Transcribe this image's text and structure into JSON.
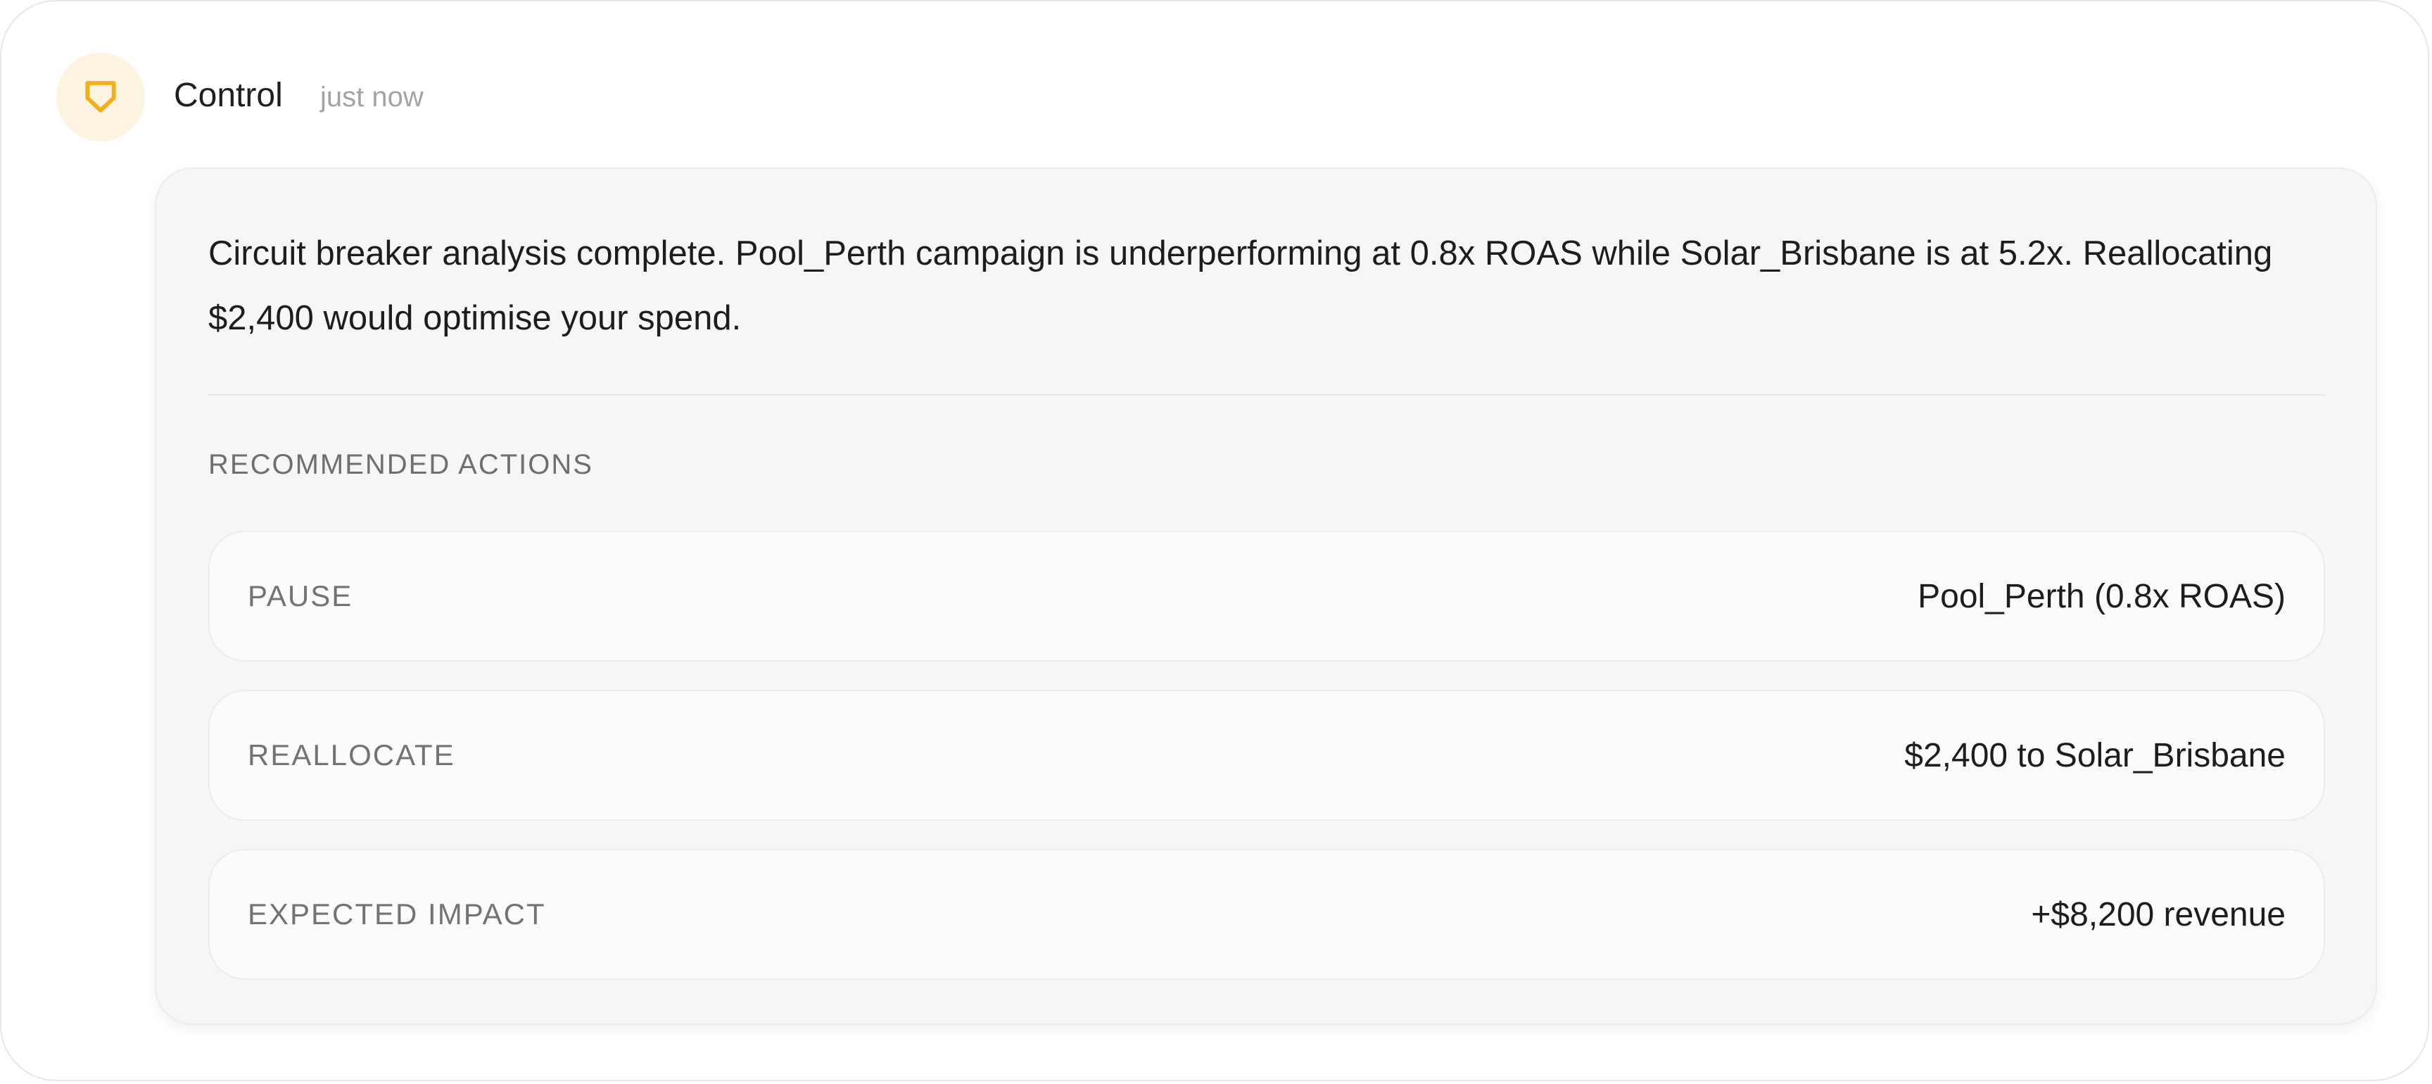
{
  "header": {
    "sender": "Control",
    "timestamp": "just now",
    "avatar_icon": "shield-icon",
    "avatar_color": "#f2b01e"
  },
  "message": {
    "text": "Circuit breaker analysis complete. Pool_Perth campaign is underperforming at 0.8x ROAS while Solar_Brisbane is at 5.2x. Reallocating $2,400 would optimise your spend."
  },
  "recommended": {
    "title": "RECOMMENDED ACTIONS",
    "actions": [
      {
        "label": "PAUSE",
        "value": "Pool_Perth (0.8x ROAS)"
      },
      {
        "label": "REALLOCATE",
        "value": "$2,400 to Solar_Brisbane"
      },
      {
        "label": "EXPECTED IMPACT",
        "value": "+$8,200 revenue"
      }
    ]
  }
}
